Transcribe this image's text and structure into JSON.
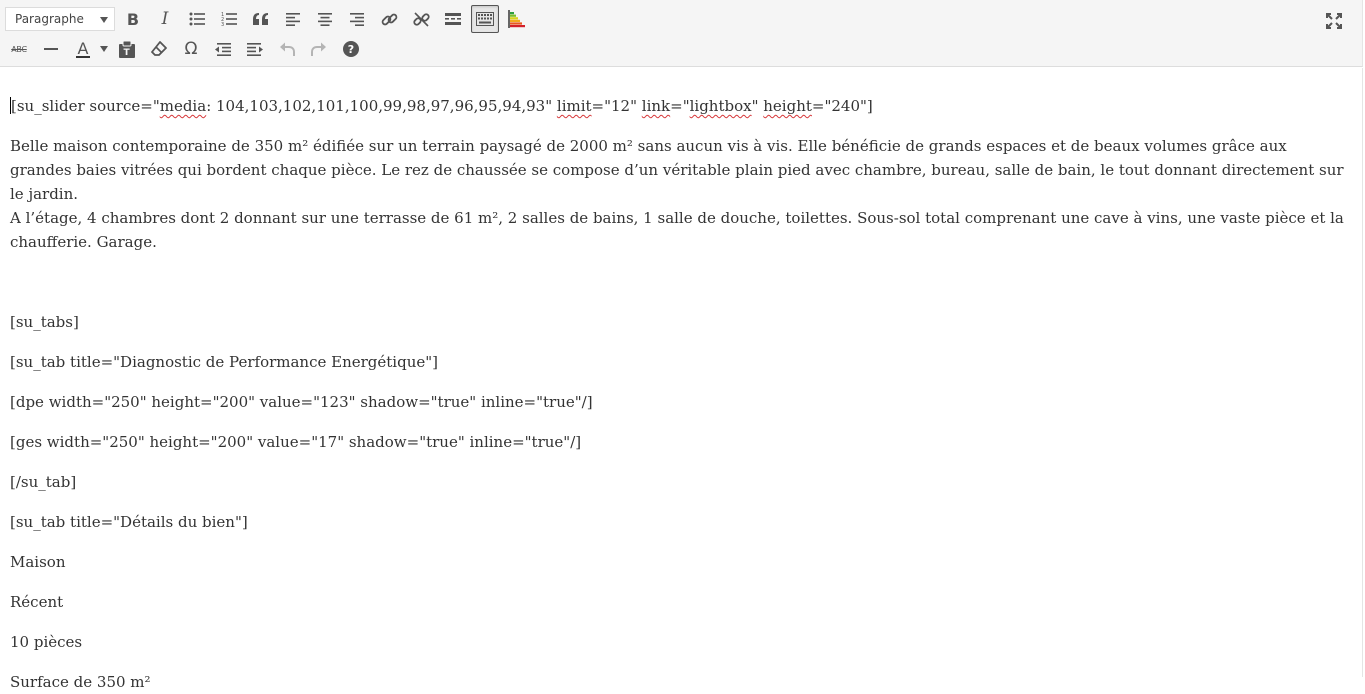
{
  "toolbar": {
    "format_select": "Paragraphe",
    "row1": [
      {
        "name": "bold-icon",
        "label": "B"
      },
      {
        "name": "italic-icon",
        "label": "I"
      },
      {
        "name": "bullet-list-icon"
      },
      {
        "name": "numbered-list-icon"
      },
      {
        "name": "blockquote-icon"
      },
      {
        "name": "align-left-icon"
      },
      {
        "name": "align-center-icon"
      },
      {
        "name": "align-right-icon"
      },
      {
        "name": "link-icon"
      },
      {
        "name": "unlink-icon"
      },
      {
        "name": "read-more-icon"
      },
      {
        "name": "toolbar-toggle-icon",
        "active": true
      },
      {
        "name": "energy-rating-icon"
      }
    ],
    "row2": [
      {
        "name": "strikethrough-icon",
        "label": "ABC"
      },
      {
        "name": "horizontal-line-icon"
      },
      {
        "name": "text-color-icon",
        "label": "A"
      },
      {
        "name": "paste-text-icon"
      },
      {
        "name": "clear-formatting-icon"
      },
      {
        "name": "special-character-icon",
        "label": "Ω"
      },
      {
        "name": "outdent-icon"
      },
      {
        "name": "indent-icon"
      },
      {
        "name": "undo-icon",
        "disabled": true
      },
      {
        "name": "redo-icon",
        "disabled": true
      },
      {
        "name": "help-icon",
        "label": "?"
      }
    ],
    "colors": {
      "text_color_underline": "#333333",
      "active_border": "#555555"
    }
  },
  "editor": {
    "slider": {
      "open": "[su_slider source=\"",
      "media": "media",
      "ids": ": 104,103,102,101,100,99,98,97,96,95,94,93\" ",
      "limit": "limit",
      "limit_rest": "=\"12\" ",
      "link": "link",
      "link_eq": "=\"",
      "lightbox": "lightbox",
      "link_close": "\" ",
      "height": "height",
      "height_rest": "=\"240\"]"
    },
    "description_line1": "Belle maison contemporaine de 350 m² édifiée sur un terrain paysagé de 2000 m² sans aucun vis à vis. Elle bénéficie de grands espaces et de beaux volumes grâce aux grandes baies vitrées qui bordent chaque pièce. Le rez de chaussée se compose d’un véritable plain pied avec chambre, bureau, salle de bain, le tout donnant directement sur le jardin.",
    "description_line2": "A l’étage, 4 chambres dont 2 donnant sur une terrasse de 61 m², 2 salles de bains, 1 salle de douche, toilettes. Sous-sol total comprenant une cave à vins, une vaste pièce et la chaufferie. Garage.",
    "lines": [
      "[su_tabs]",
      "[su_tab title=\"Diagnostic de Performance Energétique\"]",
      "[dpe width=\"250\" height=\"200\" value=\"123\" shadow=\"true\" inline=\"true\"/]",
      "[ges width=\"250\" height=\"200\" value=\"17\" shadow=\"true\" inline=\"true\"/]",
      "[/su_tab]",
      "[su_tab title=\"Détails du bien\"]",
      "Maison",
      "Récent",
      "10 pièces",
      "Surface de 350 m²"
    ]
  }
}
